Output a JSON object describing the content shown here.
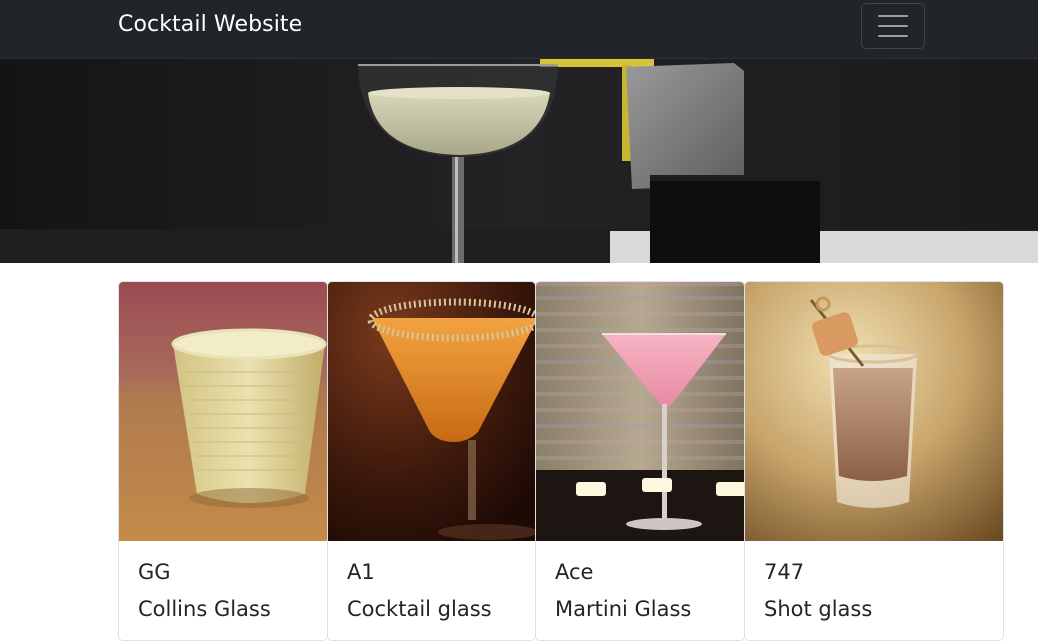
{
  "navbar": {
    "brand": "Cocktail Website",
    "toggler_icon": "hamburger-menu-icon"
  },
  "hero": {
    "image": "coupe-cocktail-glass-with-stone-blocks-banner"
  },
  "cards": [
    {
      "name": "GG",
      "glass": "Collins Glass",
      "image": "yellow-drink-in-ribbed-tumbler-photo"
    },
    {
      "name": "A1",
      "glass": "Cocktail glass",
      "image": "orange-cocktail-with-sugared-rim-photo"
    },
    {
      "name": "Ace",
      "glass": "Martini Glass",
      "image": "pink-martini-with-tealights-photo"
    },
    {
      "name": "747",
      "glass": "Shot glass",
      "image": "creamy-shot-with-caramel-skewer-photo"
    }
  ]
}
